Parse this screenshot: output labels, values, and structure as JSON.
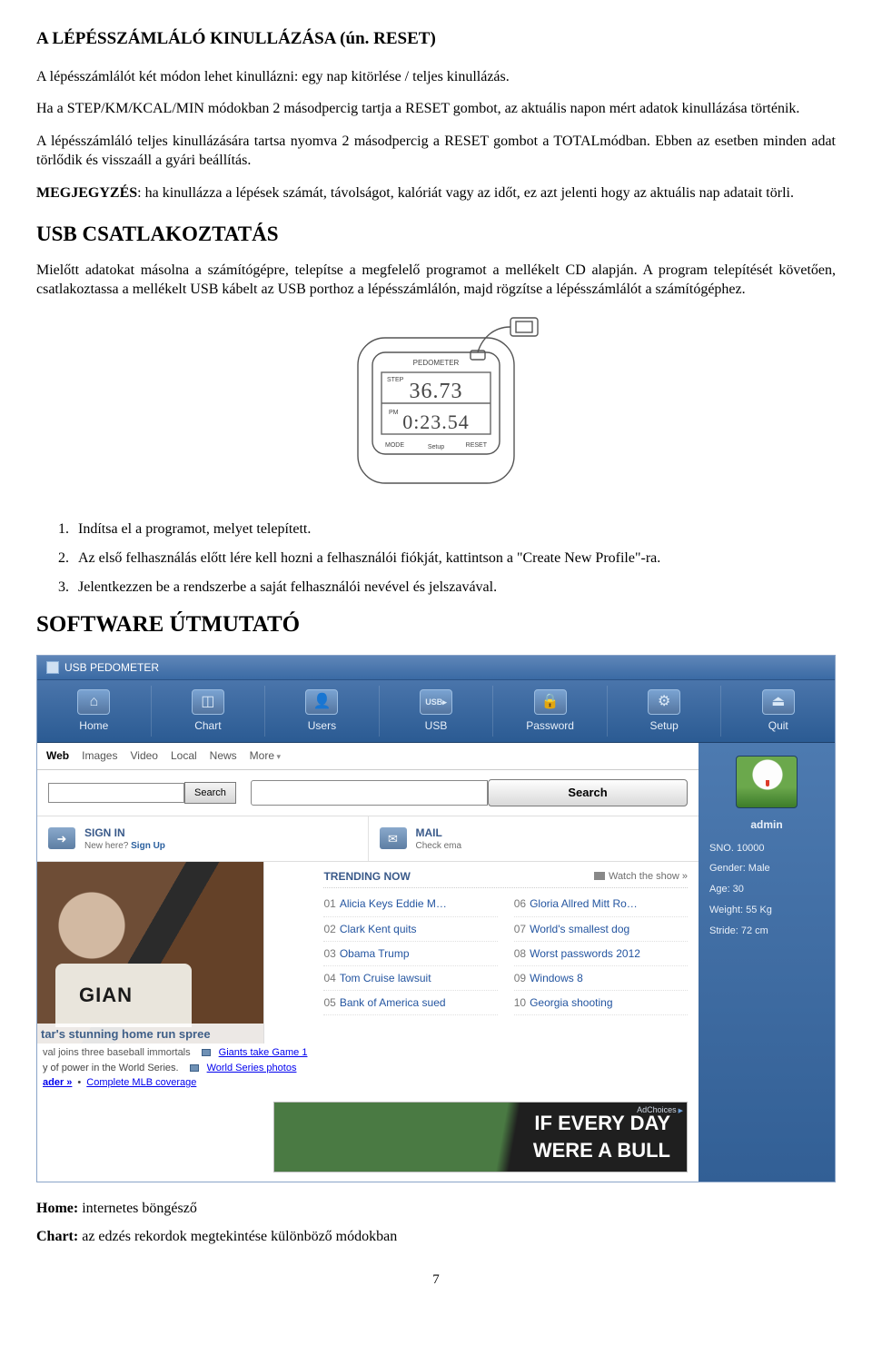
{
  "headings": {
    "reset": "A LÉPÉSSZÁMLÁLÓ KINULLÁZÁSA (ún. RESET)",
    "usb": "USB CSATLAKOZTATÁS",
    "software": "SOFTWARE  ÚTMUTATÓ"
  },
  "paragraphs": {
    "p1": "A lépésszámlálót két módon lehet kinullázni: egy nap kitörlése / teljes kinullázás.",
    "p2": "Ha a  STEP/KM/KCAL/MIN  módokban 2 másodpercig tartja a RESET gombot, az aktuális napon mért adatok kinullázása történik.",
    "p3": "A lépésszámláló teljes kinullázására tartsa nyomva 2 másodpercig a RESET gombot a TOTALmódban. Ebben az esetben minden adat törlődik és visszaáll a gyári beállítás.",
    "p4_prefix": "MEGJEGYZÉS",
    "p4_rest": ": ha kinullázza a lépések számát, távolságot, kalóriát vagy az időt, ez azt jelenti hogy az aktuális nap adatait törli.",
    "p5": "Mielőtt adatokat másolna a számítógépre, telepítse a megfelelő programot a mellékelt CD alapján. A program telepítését követően, csatlakoztassa a mellékelt USB kábelt az USB porthoz a lépésszámlálón, majd rögzítse a lépésszámlálót a számítógéphez."
  },
  "pedometer_display": {
    "label": "PEDOMETER",
    "top_left": "STEP",
    "line1": "36.73",
    "pm": "PM",
    "line2": "0:23.54",
    "mode": "MODE",
    "reset": "RESET",
    "setup": "Setup"
  },
  "steps": [
    {
      "n": "1.",
      "t": "Indítsa el a programot, melyet telepített."
    },
    {
      "n": "2.",
      "t": "Az első felhasználás előtt lére kell hozni a felhasználói fiókját, kattintson a \"Create New Profile\"-ra."
    },
    {
      "n": "3.",
      "t": "Jelentkezzen be a rendszerbe a saját felhasználói nevével  és jelszavával."
    }
  ],
  "app": {
    "title": "USB PEDOMETER",
    "toolbar": [
      {
        "label": "Home",
        "glyph": "⌂"
      },
      {
        "label": "Chart",
        "glyph": "◫"
      },
      {
        "label": "Users",
        "glyph": "👤"
      },
      {
        "label": "USB",
        "glyph": "USB▸"
      },
      {
        "label": "Password",
        "glyph": "🔒"
      },
      {
        "label": "Setup",
        "glyph": "⚙"
      },
      {
        "label": "Quit",
        "glyph": "⏏"
      }
    ],
    "webtabs": [
      "Web",
      "Images",
      "Video",
      "Local",
      "News",
      "More"
    ],
    "search_small_btn": "Search",
    "search_big_btn": "Search",
    "panels": {
      "signin": {
        "glyph": "➜",
        "title": "SIGN IN",
        "sub_plain": "New here? ",
        "sub_link": "Sign Up"
      },
      "mail": {
        "glyph": "✉",
        "title": "MAIL",
        "sub": "Check ema"
      }
    },
    "sidebar": {
      "name": "admin",
      "rows": [
        "SNO. 10000",
        "Gender: Male",
        "Age: 30",
        "Weight: 55 Kg",
        "Stride: 72 cm"
      ]
    },
    "trending": {
      "header": "TRENDING NOW",
      "watch": "Watch the show »",
      "left": [
        {
          "n": "01",
          "t": "Alicia Keys Eddie M…"
        },
        {
          "n": "02",
          "t": "Clark Kent quits"
        },
        {
          "n": "03",
          "t": "Obama Trump"
        },
        {
          "n": "04",
          "t": "Tom Cruise lawsuit"
        },
        {
          "n": "05",
          "t": "Bank of America sued"
        }
      ],
      "right": [
        {
          "n": "06",
          "t": "Gloria Allred Mitt Ro…"
        },
        {
          "n": "07",
          "t": "World's smallest dog"
        },
        {
          "n": "08",
          "t": "Worst passwords 2012"
        },
        {
          "n": "09",
          "t": "Windows 8"
        },
        {
          "n": "10",
          "t": "Georgia shooting"
        }
      ]
    },
    "hero_caption": "tar's stunning home run spree",
    "below_hero": {
      "line1": "val joins three baseball immortals",
      "link1": "Giants take Game 1",
      "line2a": "y of power in the World Series.",
      "link2": "World Series photos",
      "line3a": "ader »",
      "link3": "Complete MLB coverage"
    },
    "ad": {
      "l1": "IF EVERY DAY",
      "l2": "WERE A BULL",
      "choices": "AdChoices"
    }
  },
  "footer_defs": [
    {
      "label": "Home:",
      "text": " internetes böngésző"
    },
    {
      "label": "Chart:",
      "text": " az edzés rekordok megtekintése különböző módokban"
    }
  ],
  "page_number": "7"
}
